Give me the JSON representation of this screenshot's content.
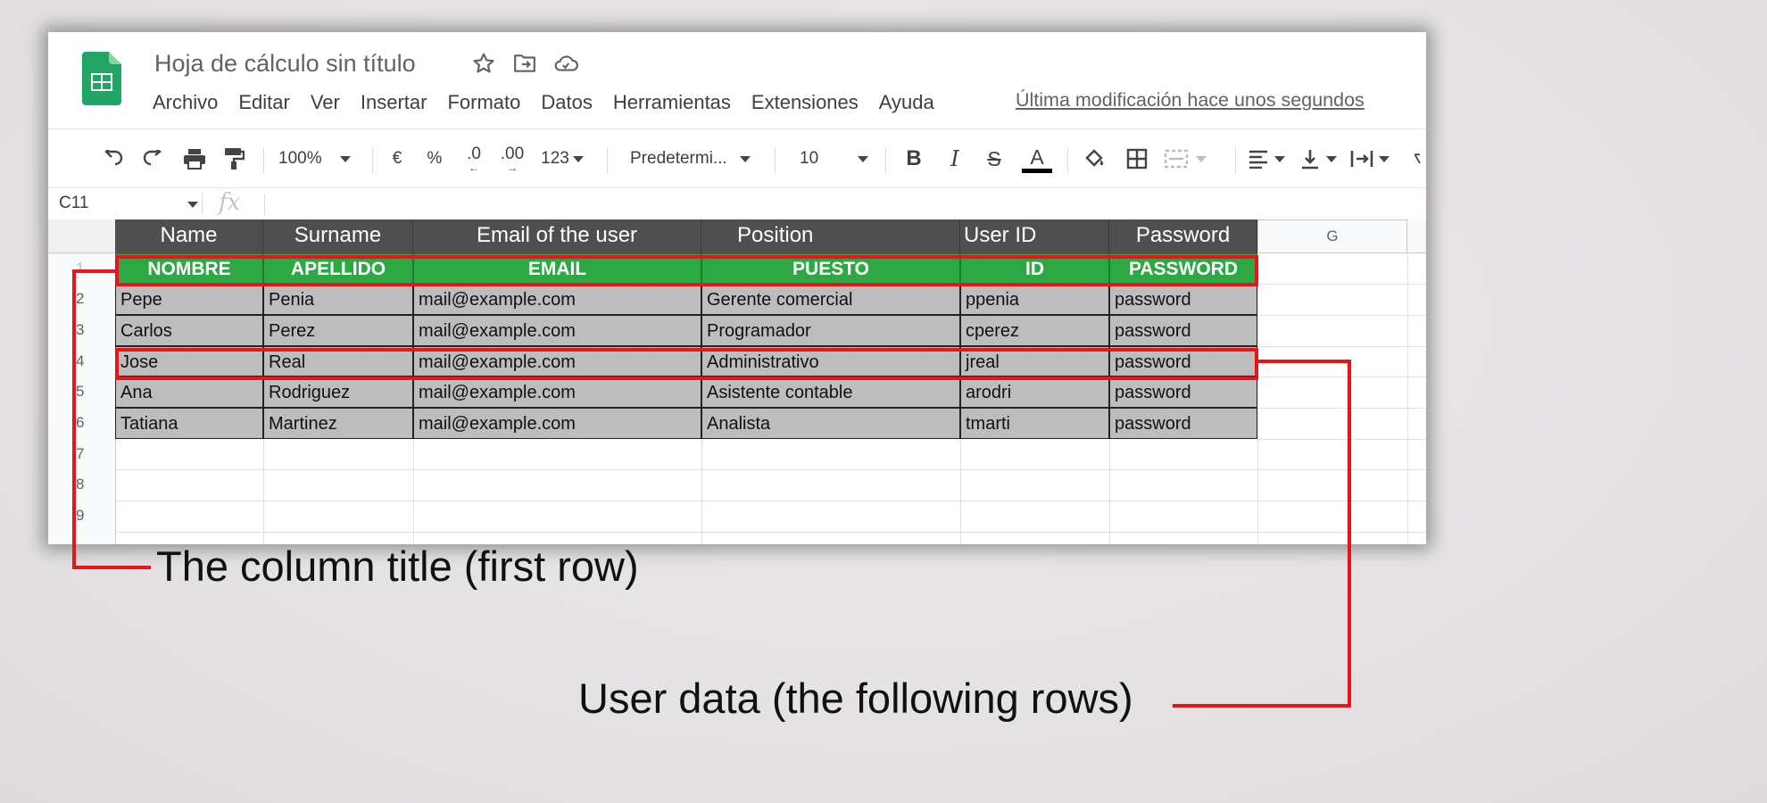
{
  "app": {
    "doc_title": "Hoja de cálculo sin título",
    "menu": [
      "Archivo",
      "Editar",
      "Ver",
      "Insertar",
      "Formato",
      "Datos",
      "Herramientas",
      "Extensiones",
      "Ayuda"
    ],
    "last_modified": "Última modificación hace unos segundos"
  },
  "toolbar": {
    "zoom": "100%",
    "currency": "€",
    "percent": "%",
    "dec_decrease": ".0",
    "dec_increase": ".00",
    "more_formats": "123",
    "font": "Predetermi...",
    "font_size": "10"
  },
  "formula_bar": {
    "cell_ref": "C11",
    "fx": "fx"
  },
  "sheet": {
    "column_overlay_headers": [
      "Name",
      "Surname",
      "Email of the user",
      "Position",
      "User ID",
      "Password"
    ],
    "column_g": "G",
    "row_numbers": [
      "1",
      "2",
      "3",
      "4",
      "5",
      "6",
      "7",
      "8",
      "9"
    ],
    "title_row": [
      "NOMBRE",
      "APELLIDO",
      "EMAIL",
      "PUESTO",
      "ID",
      "PASSWORD"
    ],
    "rows": [
      [
        "Pepe",
        "Penia",
        "mail@example.com",
        "Gerente comercial",
        "ppenia",
        "password"
      ],
      [
        "Carlos",
        "Perez",
        "mail@example.com",
        "Programador",
        "cperez",
        "password"
      ],
      [
        "Jose",
        "Real",
        "mail@example.com",
        "Administrativo",
        "jreal",
        "password"
      ],
      [
        "Ana",
        "Rodriguez",
        "mail@example.com",
        "Asistente contable",
        "arodri",
        "password"
      ],
      [
        "Tatiana",
        "Martinez",
        "mail@example.com",
        "Analista",
        "tmarti",
        "password"
      ]
    ]
  },
  "annotations": {
    "title_row": "The column title (first row)",
    "user_data": "User data (the following rows)"
  },
  "colors": {
    "highlight": "#e8141b",
    "title_row_bg": "#2ea745",
    "sheets_green": "#23a566"
  }
}
